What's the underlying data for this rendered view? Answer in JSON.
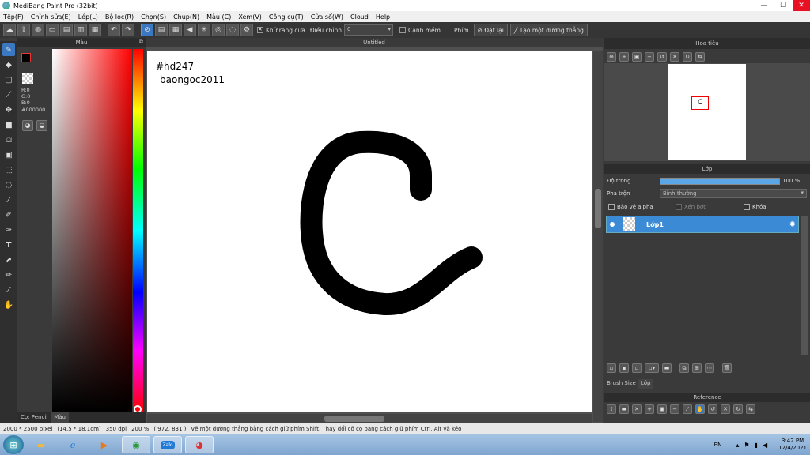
{
  "window": {
    "title": "MediBang Paint Pro (32bit)",
    "minimize": "—",
    "maximize": "☐",
    "close": "✕"
  },
  "menu": [
    "Tệp(F)",
    "Chỉnh sửa(E)",
    "Lớp(L)",
    "Bộ lọc(R)",
    "Chọn(S)",
    "Chụp(N)",
    "Màu (C)",
    "Xem(V)",
    "Công cụ(T)",
    "Cửa sổ(W)",
    "Cloud",
    "Help"
  ],
  "toolbar": {
    "antialias_label": "Khử răng cưa",
    "correction_label": "Điều chỉnh",
    "correction_value": "0",
    "sharp_edge_label": "Cạnh mềm",
    "brush_label": "Phím",
    "reset_label": "Đặt lại",
    "line_label": "Tạo một đường thẳng"
  },
  "color_panel": {
    "title": "Màu",
    "r": "R:0",
    "g": "G:0",
    "b": "B:0",
    "hex": "#000000",
    "tab_pencil": "Cọ: Pencil",
    "tab_color": "Màu",
    "fg_color": "#000000",
    "bg_color": "#ffffff"
  },
  "canvas": {
    "title": "Untitled",
    "text_line1": "#hd247",
    "text_line2": "baongoc2011"
  },
  "navigator": {
    "title": "Hoa tiêu",
    "preview_letter": "C"
  },
  "layers": {
    "title": "Lớp",
    "opacity_label": "Độ trong",
    "opacity_value": "100 %",
    "opacity_fraction": 1.0,
    "blend_label": "Pha trộn",
    "blend_value": "Bình thường",
    "protect_alpha": "Bảo vệ alpha",
    "clipping": "Xén bớt",
    "lock": "Khóa",
    "layer_name": "Lớp1",
    "tab_brush_size": "Brush Size",
    "tab_layer": "Lớp"
  },
  "reference": {
    "title": "Reference"
  },
  "status": {
    "size": "2000 * 2500 pixel",
    "cm": "(14.5 * 18.1cm)",
    "dpi": "350 dpi",
    "zoom": "200 %",
    "coords": "( 972, 831 )",
    "hint": "Vẽ một đường thẳng bằng cách giữ phím Shift, Thay đổi cỡ cọ bằng cách giữ phím Ctrl, Alt và kéo"
  },
  "taskbar": {
    "lang": "EN",
    "time": "3:42 PM",
    "date": "12/4/2021",
    "apps": [
      "folder-icon",
      "ie-icon",
      "media-icon",
      "green-app-icon",
      "zalo-icon",
      "medibang-icon"
    ],
    "zalo_label": "Zalo"
  }
}
